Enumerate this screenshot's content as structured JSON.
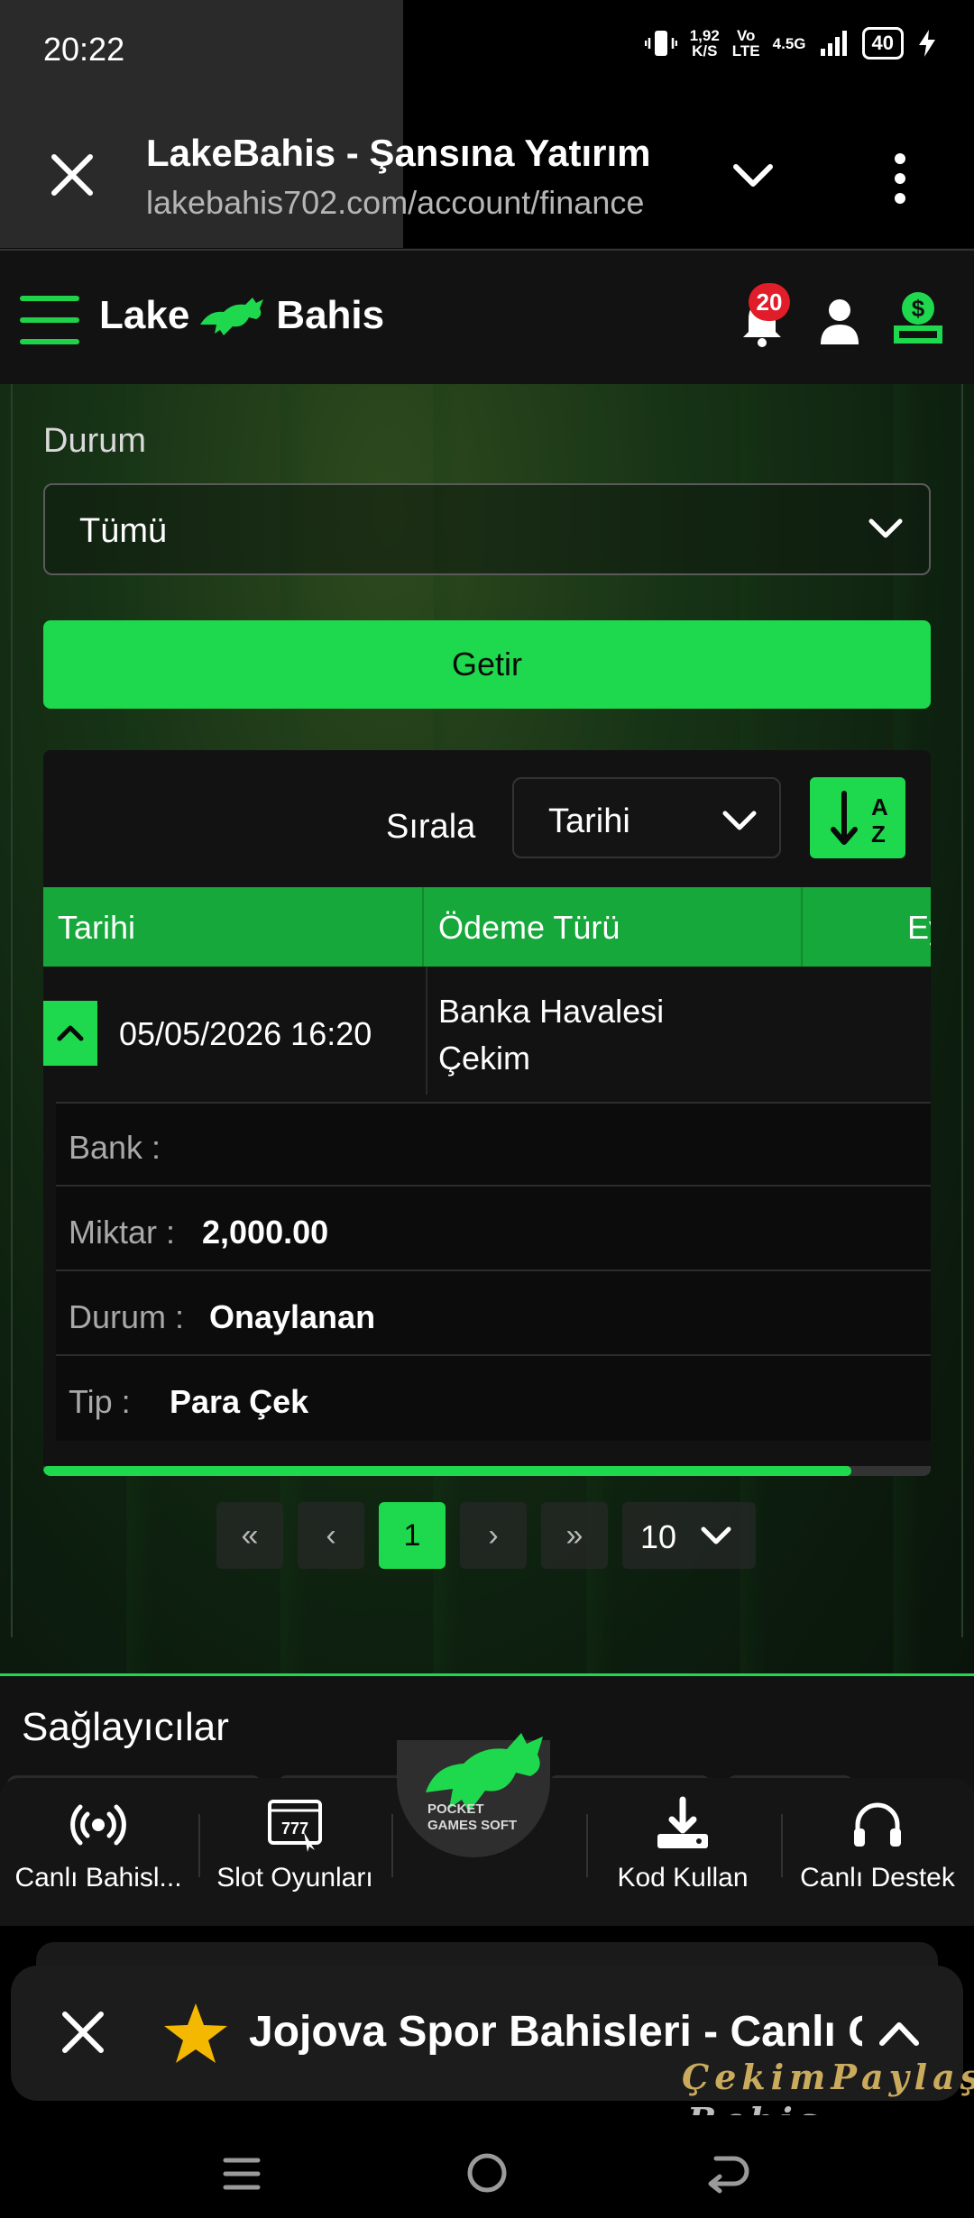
{
  "status_bar": {
    "time": "20:22",
    "net_speed_top": "1,92",
    "net_speed_unit": "K/S",
    "volte_top": "Vo",
    "volte_bottom": "LTE",
    "network": "4.5G",
    "battery": "40"
  },
  "browser": {
    "title": "LakeBahis - Şansına Yatırım",
    "url": "lakebahis702.com/account/finance"
  },
  "header": {
    "logo_left": "Lake",
    "logo_right": "Bahis",
    "notification_count": "20",
    "accent": "#1ed94d"
  },
  "filter": {
    "status_label": "Durum",
    "status_value": "Tümü",
    "submit_label": "Getir"
  },
  "sort": {
    "label": "Sırala",
    "value": "Tarihi",
    "az_top": "A",
    "az_bottom": "Z"
  },
  "table": {
    "columns": [
      "Tarihi",
      "Ödeme Türü",
      "Ey"
    ],
    "rows": [
      {
        "date": "05/05/2026 16:20",
        "type_line1": "Banka Havalesi",
        "type_line2": "Çekim"
      }
    ],
    "details": [
      {
        "key": "Bank :",
        "value": ""
      },
      {
        "key": "Miktar :",
        "value": "2,000.00"
      },
      {
        "key": "Durum :",
        "value": "Onaylanan"
      },
      {
        "key": "Tip :",
        "value": "Para Çek"
      }
    ]
  },
  "pagination": {
    "first": "«",
    "prev": "‹",
    "current": "1",
    "next": "›",
    "last": "»",
    "page_size": "10"
  },
  "providers": {
    "title": "Sağlayıcılar",
    "center_label": "POCKET GAMES SOFT"
  },
  "bottom_nav": {
    "items": [
      {
        "label": "Canlı Bahisl...",
        "icon": "broadcast-icon"
      },
      {
        "label": "Slot Oyunları",
        "icon": "slot-machine-icon"
      },
      {
        "label": "Kod Kullan",
        "icon": "download-icon"
      },
      {
        "label": "Canlı Destek",
        "icon": "headset-icon"
      }
    ]
  },
  "banner": {
    "text": "Jojova Spor Bahisleri - Canlı Casino"
  },
  "watermark": {
    "line1": "ÇekimPaylaş",
    "line2": "Bahis Forum"
  }
}
